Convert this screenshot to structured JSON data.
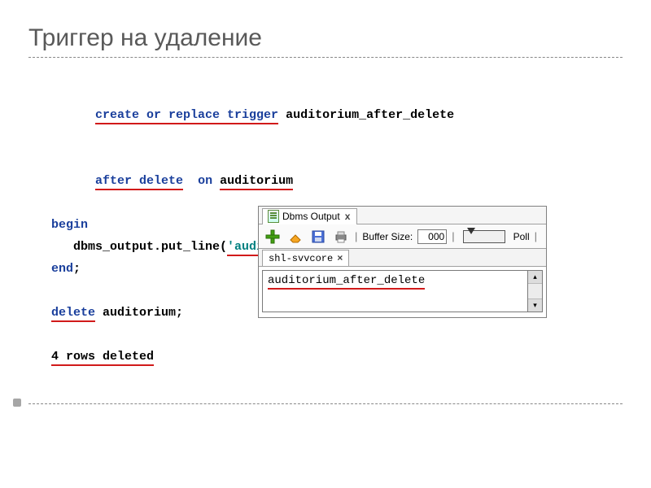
{
  "slide": {
    "title": "Триггер на удаление"
  },
  "code": {
    "create": "create or replace trigger",
    "trigger_name": "auditorium_after_delete",
    "after": "after delete",
    "on": "on",
    "table": "auditorium",
    "begin": "begin",
    "call_a": "dbms_output.put_line(",
    "call_str": "'auditorium_after_delete'",
    "call_b": ");",
    "end": "end",
    "semicolon": ";",
    "delete": "delete",
    "delete_tbl": "auditorium;",
    "result": "4 rows deleted"
  },
  "panel": {
    "tab_title": "Dbms Output",
    "buffer_label": "Buffer Size:",
    "buffer_value": "000",
    "poll_label": "Poll",
    "subtab": "shl-svvcore",
    "output_line": "auditorium_after_delete"
  }
}
